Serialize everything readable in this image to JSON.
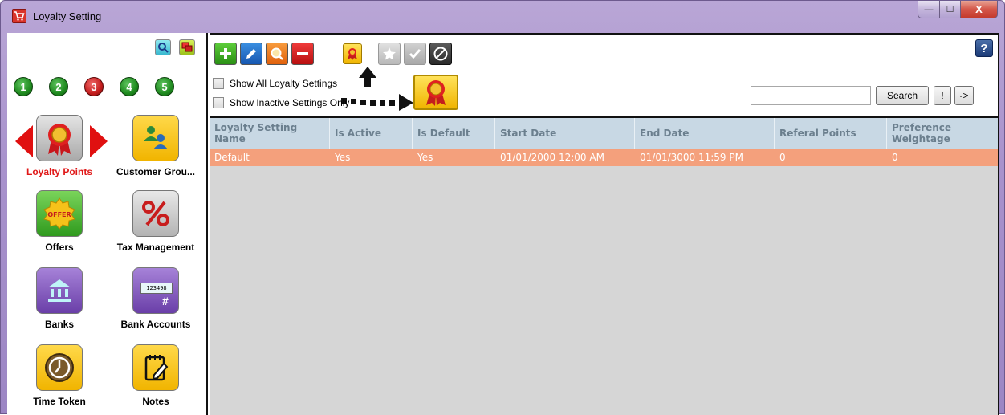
{
  "window": {
    "title": "Loyalty Setting",
    "min_glyph": "—",
    "max_glyph": "☐",
    "close_glyph": "X"
  },
  "sidebar": {
    "number_buttons": [
      "1",
      "2",
      "3",
      "4",
      "5"
    ],
    "active_number": "3",
    "modules": [
      {
        "label": "Loyalty Points",
        "icon": "ribbon-award-icon",
        "active": true
      },
      {
        "label": "Customer Grou...",
        "icon": "customer-group-icon",
        "active": false
      },
      {
        "label": "Offers",
        "icon": "offer-badge-icon",
        "active": false
      },
      {
        "label": "Tax Management",
        "icon": "percent-icon",
        "active": false
      },
      {
        "label": "Banks",
        "icon": "bank-icon",
        "active": false
      },
      {
        "label": "Bank Accounts",
        "icon": "bank-card-icon",
        "active": false
      },
      {
        "label": "Time Token",
        "icon": "clock-icon",
        "active": false
      },
      {
        "label": "Notes",
        "icon": "notepad-icon",
        "active": false
      }
    ],
    "bank_account_card_text": "123498",
    "bank_account_card_hash": "#"
  },
  "toolbar": {
    "help_label": "?"
  },
  "filters": {
    "show_all_label": "Show All Loyalty Settings",
    "show_inactive_label": "Show Inactive Settings Only"
  },
  "search": {
    "value": "",
    "placeholder": "",
    "button_label": "Search",
    "bang_label": "!",
    "arrow_label": "->"
  },
  "grid": {
    "columns": [
      "Loyalty Setting Name",
      "Is Active",
      "Is Default",
      "Start Date",
      "End Date",
      "Referal Points",
      "Preference Weightage"
    ],
    "rows": [
      [
        "Default",
        "Yes",
        "Yes",
        "01/01/2000 12:00 AM",
        "01/01/3000 11:59 PM",
        "0",
        "0"
      ]
    ]
  },
  "colors": {
    "selected_row": "#f4a07c",
    "header_bg": "#c8d8e4",
    "grid_bg": "#d6d6d6",
    "active_module": "#e01818"
  }
}
